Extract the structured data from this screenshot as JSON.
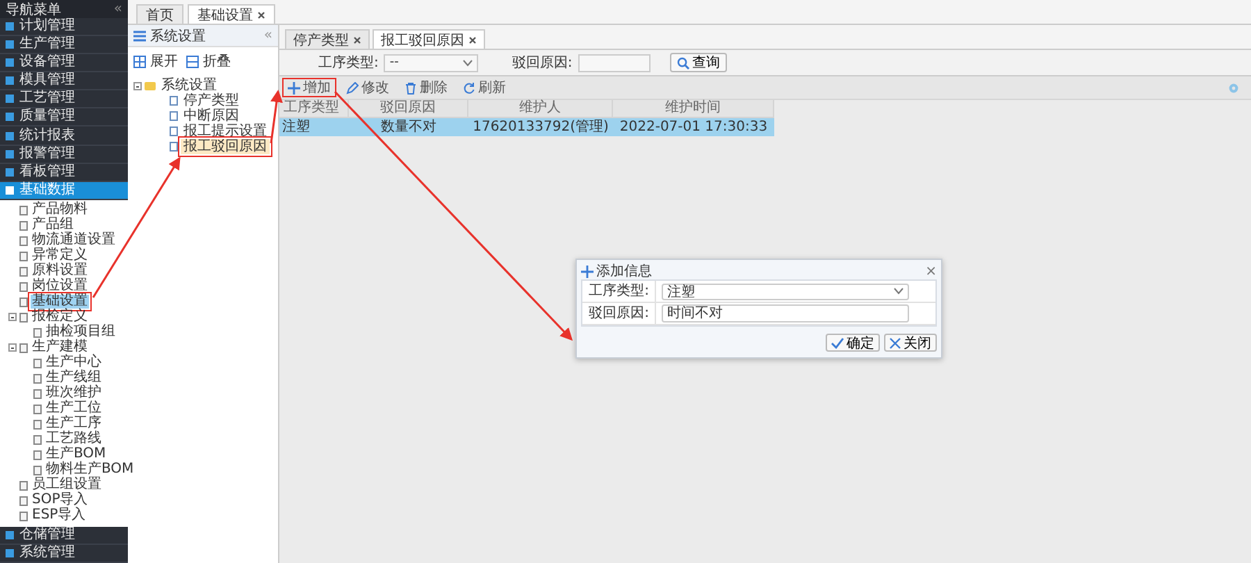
{
  "sidebar": {
    "title": "导航菜单",
    "collapse": "«",
    "menu": [
      {
        "label": "计划管理",
        "selected": false
      },
      {
        "label": "生产管理",
        "selected": false
      },
      {
        "label": "设备管理",
        "selected": false
      },
      {
        "label": "模具管理",
        "selected": false
      },
      {
        "label": "工艺管理",
        "selected": false
      },
      {
        "label": "质量管理",
        "selected": false
      },
      {
        "label": "统计报表",
        "selected": false
      },
      {
        "label": "报警管理",
        "selected": false
      },
      {
        "label": "看板管理",
        "selected": false
      },
      {
        "label": "基础数据",
        "selected": true
      }
    ],
    "tree": [
      {
        "label": "产品物料",
        "selected": false,
        "callout": false
      },
      {
        "label": "产品组",
        "selected": false,
        "callout": false
      },
      {
        "label": "物流通道设置",
        "selected": false,
        "callout": false
      },
      {
        "label": "异常定义",
        "selected": false,
        "callout": false
      },
      {
        "label": "原料设置",
        "selected": false,
        "callout": false
      },
      {
        "label": "岗位设置",
        "selected": false,
        "callout": false
      },
      {
        "label": "基础设置",
        "selected": true,
        "callout": true
      },
      {
        "label": "报检定义",
        "selected": false,
        "callout": false,
        "expanded": true,
        "children": [
          {
            "label": "抽检项目组",
            "selected": false,
            "callout": false
          }
        ]
      },
      {
        "label": "生产建模",
        "selected": false,
        "callout": false,
        "expanded": true,
        "children": [
          {
            "label": "生产中心",
            "selected": false,
            "callout": false
          },
          {
            "label": "生产线组",
            "selected": false,
            "callout": false
          },
          {
            "label": "班次维护",
            "selected": false,
            "callout": false
          },
          {
            "label": "生产工位",
            "selected": false,
            "callout": false
          },
          {
            "label": "生产工序",
            "selected": false,
            "callout": false
          },
          {
            "label": "工艺路线",
            "selected": false,
            "callout": false
          },
          {
            "label": "生产BOM",
            "selected": false,
            "callout": false
          },
          {
            "label": "物料生产BOM",
            "selected": false,
            "callout": false
          }
        ]
      },
      {
        "label": "员工组设置",
        "selected": false,
        "callout": false
      },
      {
        "label": "SOP导入",
        "selected": false,
        "callout": false
      },
      {
        "label": "ESP导入",
        "selected": false,
        "callout": false
      }
    ],
    "menu_bottom": [
      {
        "label": "仓储管理",
        "selected": false
      },
      {
        "label": "系统管理",
        "selected": false
      }
    ]
  },
  "app_tabs": [
    {
      "label": "首页",
      "selected": false,
      "closable": false
    },
    {
      "label": "基础设置",
      "selected": true,
      "closable": true
    }
  ],
  "settings_panel": {
    "title": "系统设置",
    "collapse": "«",
    "buttons": [
      {
        "label": "展开",
        "kind": "expand"
      },
      {
        "label": "折叠",
        "kind": "collapse"
      }
    ],
    "tree": [
      {
        "label": "系统设置",
        "selected": false,
        "callout": false,
        "expanded": true,
        "children": [
          {
            "label": "停产类型",
            "selected": false,
            "callout": false
          },
          {
            "label": "中断原因",
            "selected": false,
            "callout": false
          },
          {
            "label": "报工提示设置",
            "selected": false,
            "callout": false
          },
          {
            "label": "报工驳回原因",
            "selected": true,
            "callout": true
          }
        ]
      }
    ]
  },
  "content_tabs": [
    {
      "label": "停产类型",
      "selected": false
    },
    {
      "label": "报工驳回原因",
      "selected": true
    }
  ],
  "filters": [
    {
      "label": "工序类型:",
      "kind": "select",
      "value": "--"
    },
    {
      "label": "驳回原因:",
      "kind": "input"
    }
  ],
  "search_button": "查询",
  "toolbar": [
    {
      "label": "增加",
      "kind": "add",
      "callout": true
    },
    {
      "label": "修改",
      "kind": "edit",
      "callout": false
    },
    {
      "label": "删除",
      "kind": "delete",
      "callout": false
    },
    {
      "label": "刷新",
      "kind": "refresh",
      "callout": false
    }
  ],
  "table": {
    "columns": [
      "工序类型",
      "驳回原因",
      "维护人",
      "维护时间"
    ],
    "rows": [
      {
        "cells": [
          "注塑",
          "数量不对",
          "17620133792(管理)",
          "2022-07-01 17:30:33"
        ],
        "selected": true
      }
    ]
  },
  "dialog": {
    "title": "添加信息",
    "close": "×",
    "fields": [
      {
        "label": "工序类型:",
        "kind": "select",
        "value": "注塑"
      },
      {
        "label": "驳回原因:",
        "kind": "input",
        "value": "时间不对"
      }
    ],
    "buttons": [
      {
        "label": "确定",
        "kind": "ok"
      },
      {
        "label": "关闭",
        "kind": "close"
      }
    ]
  }
}
